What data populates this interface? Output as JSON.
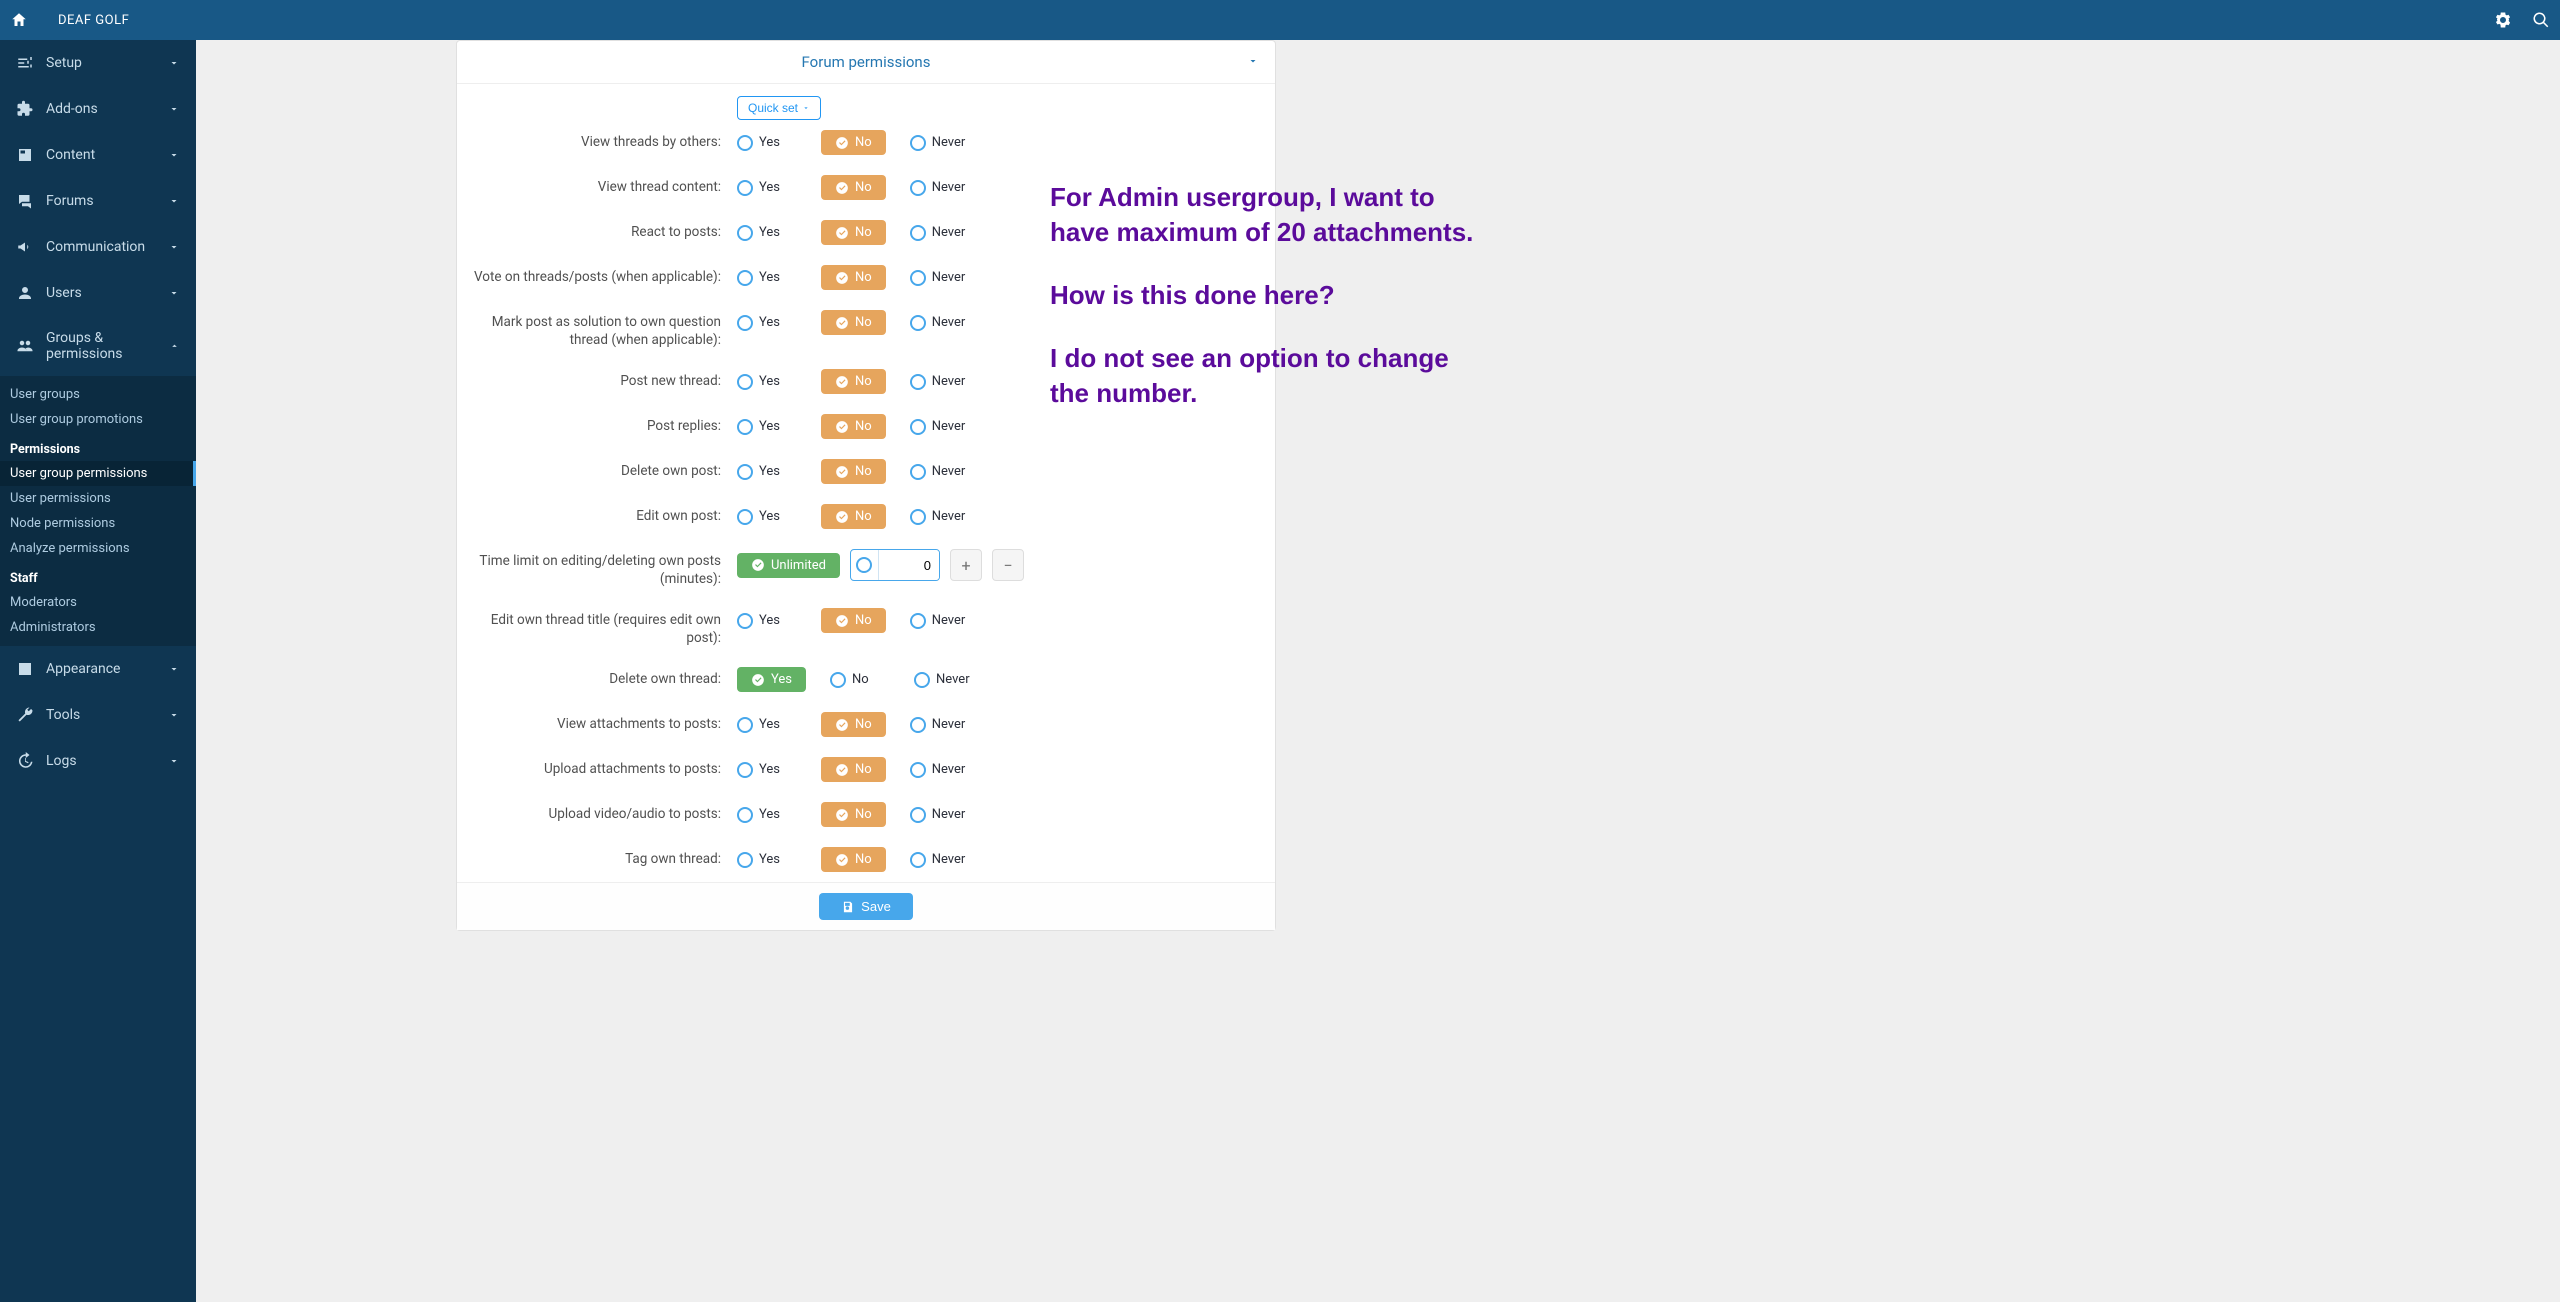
{
  "header": {
    "site_title": "DEAF GOLF"
  },
  "sidebar": {
    "items": [
      {
        "label": "Setup"
      },
      {
        "label": "Add-ons"
      },
      {
        "label": "Content"
      },
      {
        "label": "Forums"
      },
      {
        "label": "Communication"
      },
      {
        "label": "Users"
      },
      {
        "label": "Groups & permissions"
      },
      {
        "label": "Appearance"
      },
      {
        "label": "Tools"
      },
      {
        "label": "Logs"
      }
    ],
    "groups_sub": {
      "user_groups": "User groups",
      "user_group_promotions": "User group promotions",
      "header_permissions": "Permissions",
      "user_group_permissions": "User group permissions",
      "user_permissions": "User permissions",
      "node_permissions": "Node permissions",
      "analyze_permissions": "Analyze permissions",
      "header_staff": "Staff",
      "moderators": "Moderators",
      "administrators": "Administrators"
    }
  },
  "panel": {
    "title": "Forum permissions",
    "quick_set": "Quick set",
    "save": "Save",
    "options": {
      "yes": "Yes",
      "no": "No",
      "never": "Never",
      "unlimited": "Unlimited"
    },
    "rows": [
      {
        "label": "View threads by others:",
        "state": "no"
      },
      {
        "label": "View thread content:",
        "state": "no"
      },
      {
        "label": "React to posts:",
        "state": "no"
      },
      {
        "label": "Vote on threads/posts (when applicable):",
        "state": "no"
      },
      {
        "label": "Mark post as solution to own question thread (when applicable):",
        "state": "no"
      },
      {
        "label": "Post new thread:",
        "state": "no"
      },
      {
        "label": "Post replies:",
        "state": "no"
      },
      {
        "label": "Delete own post:",
        "state": "no"
      },
      {
        "label": "Edit own post:",
        "state": "no"
      },
      {
        "label": "Time limit on editing/deleting own posts (minutes):",
        "state": "numeric",
        "value": "0"
      },
      {
        "label": "Edit own thread title (requires edit own post):",
        "state": "no"
      },
      {
        "label": "Delete own thread:",
        "state": "yes"
      },
      {
        "label": "View attachments to posts:",
        "state": "no"
      },
      {
        "label": "Upload attachments to posts:",
        "state": "no"
      },
      {
        "label": "Upload video/audio to posts:",
        "state": "no"
      },
      {
        "label": "Tag own thread:",
        "state": "no"
      }
    ]
  },
  "annotation": {
    "p1": "For Admin usergroup, I want to have maximum of 20 attachments.",
    "p2": "How is this done here?",
    "p3": "I do not see an option to change the number."
  }
}
